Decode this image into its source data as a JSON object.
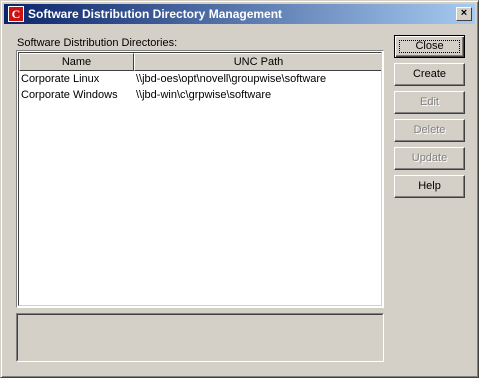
{
  "window": {
    "title": "Software Distribution Directory Management",
    "close_glyph": "×"
  },
  "list": {
    "label": "Software Distribution Directories:",
    "columns": [
      "Name",
      "UNC Path"
    ],
    "rows": [
      {
        "name": "Corporate Linux",
        "path": "\\\\jbd-oes\\opt\\novell\\groupwise\\software"
      },
      {
        "name": "Corporate Windows",
        "path": "\\\\jbd-win\\c\\grpwise\\software"
      }
    ]
  },
  "buttons": {
    "close": "Close",
    "create": "Create",
    "edit": "Edit",
    "delete": "Delete",
    "update": "Update",
    "help": "Help"
  },
  "colors": {
    "titlebar_start": "#0a246a",
    "titlebar_end": "#a6caf0",
    "face": "#d4d0c8"
  }
}
